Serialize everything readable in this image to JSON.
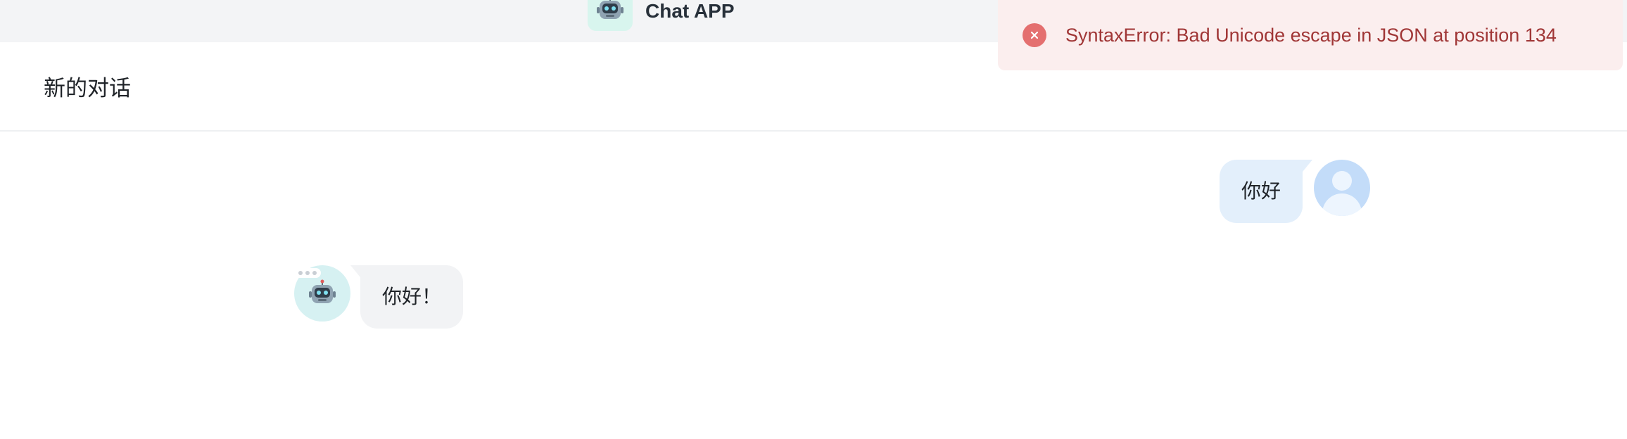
{
  "header": {
    "app_title": "Chat APP",
    "logo_icon": "robot-icon"
  },
  "conversation": {
    "title": "新的对话"
  },
  "messages": [
    {
      "role": "user",
      "text": "你好",
      "avatar_icon": "user-avatar-icon"
    },
    {
      "role": "assistant",
      "text": "你好！",
      "avatar_icon": "robot-icon"
    }
  ],
  "toast": {
    "type": "error",
    "icon": "close-circle-icon",
    "text": "SyntaxError: Bad Unicode escape in JSON at position 134"
  },
  "colors": {
    "topbar_bg": "#f3f4f6",
    "user_bubble": "#e3effb",
    "bot_bubble": "#f2f3f5",
    "toast_bg": "#fbeeee",
    "toast_text": "#a03636",
    "toast_icon": "#e46f6f"
  }
}
